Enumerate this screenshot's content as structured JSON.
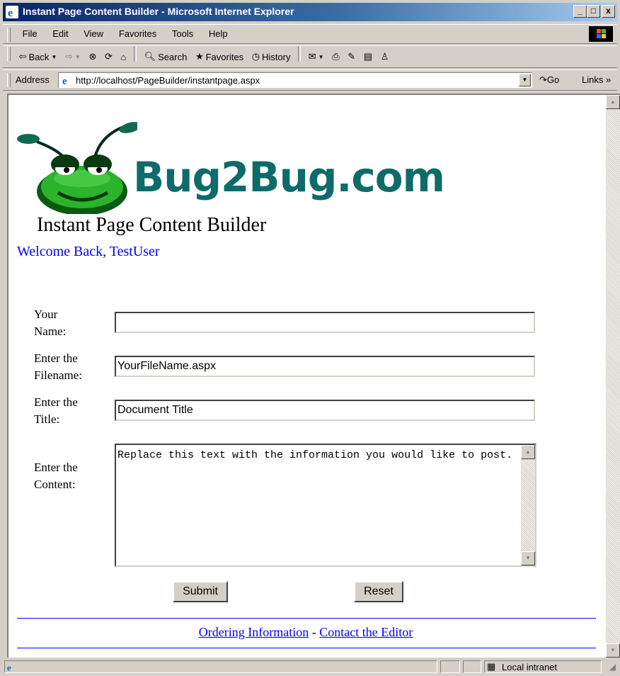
{
  "window": {
    "title": "Instant Page Content Builder - Microsoft Internet Explorer",
    "controls": {
      "minimize": "_",
      "maximize": "□",
      "close": "x"
    }
  },
  "menu": [
    "File",
    "Edit",
    "View",
    "Favorites",
    "Tools",
    "Help"
  ],
  "toolbar": {
    "back": "Back",
    "search": "Search",
    "favorites": "Favorites",
    "history": "History"
  },
  "address": {
    "label": "Address",
    "url": "http://localhost/PageBuilder/instantpage.aspx",
    "go": "Go",
    "links": "Links"
  },
  "page": {
    "brand": "Bug2Bug.com",
    "heading": "Instant Page Content Builder",
    "welcome": "Welcome Back, TestUser",
    "form": {
      "name_label": "Your Name:",
      "name_value": "",
      "filename_label": "Enter the Filename:",
      "filename_value": "YourFileName.aspx",
      "title_label": "Enter the Title:",
      "title_value": "Document Title",
      "content_label": "Enter the Content:",
      "content_value": "Replace this text with the information you would like to post.",
      "submit": "Submit",
      "reset": "Reset"
    },
    "footer": {
      "ordering": "Ordering Information",
      "separator": " - ",
      "contact": "Contact the Editor"
    }
  },
  "status": {
    "zone": "Local intranet"
  },
  "colors": {
    "link": "#0000ff",
    "brand": "#0e6b6a",
    "titlebar": "#0a246a"
  }
}
